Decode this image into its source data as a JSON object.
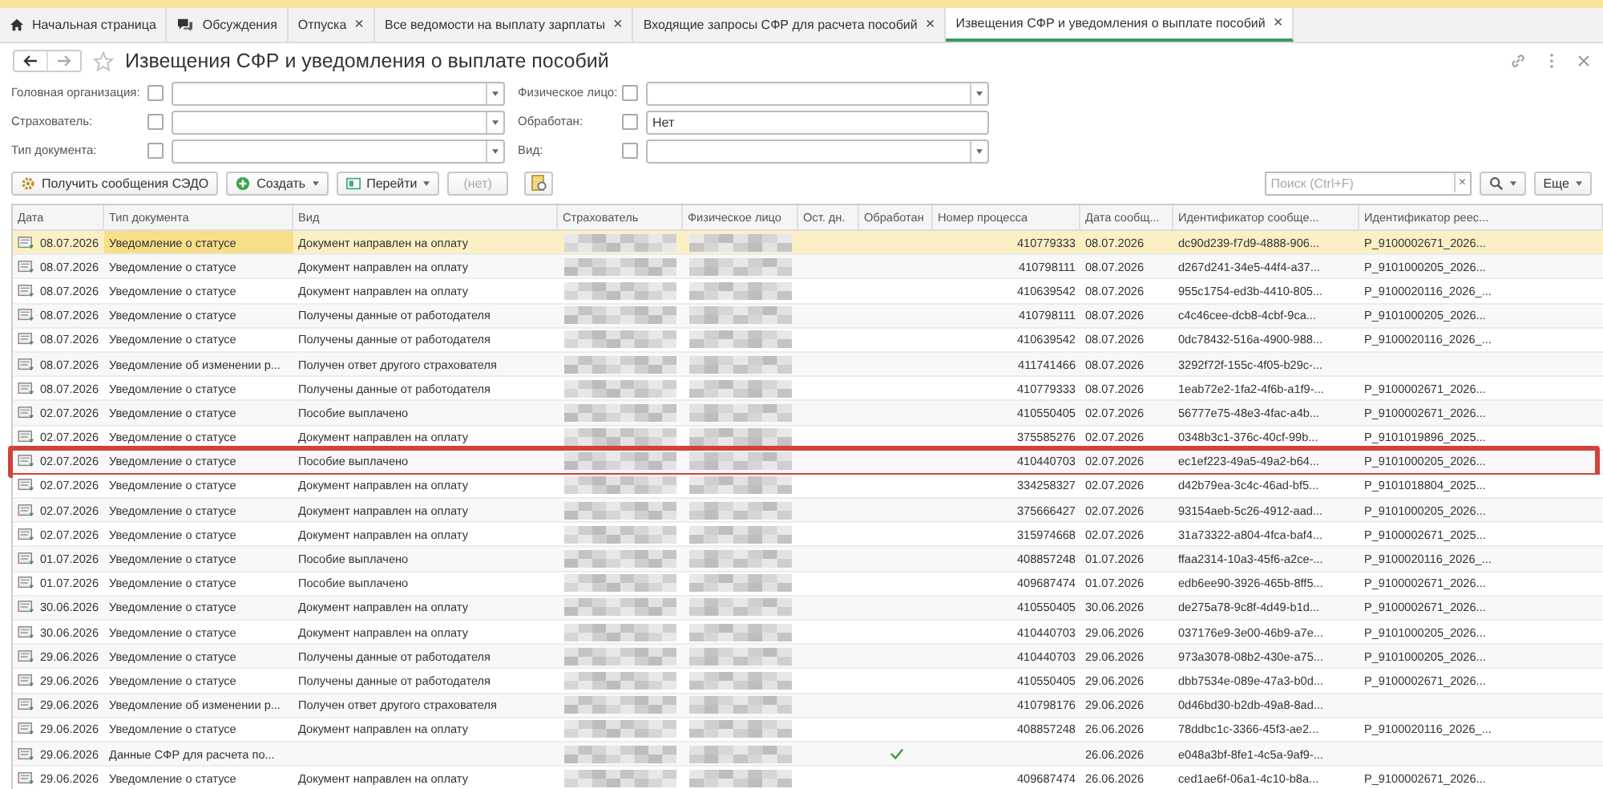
{
  "tabs": [
    {
      "label": "Начальная страница",
      "kind": "home",
      "selected": false
    },
    {
      "label": "Обсуждения",
      "kind": "chat",
      "selected": false
    },
    {
      "label": "Отпуска",
      "kind": "plain",
      "close": "×",
      "selected": false
    },
    {
      "label": "Все ведомости на выплату зарплаты",
      "kind": "plain",
      "close": "×",
      "selected": false
    },
    {
      "label": "Входящие запросы СФР для расчета пособий",
      "kind": "plain",
      "close": "×",
      "selected": false
    },
    {
      "label": "Извещения СФР и уведомления о выплате пособий",
      "kind": "plain",
      "close": "×",
      "selected": true
    }
  ],
  "title": "Извещения СФР и уведомления о выплате пособий",
  "filters_left": [
    {
      "label": "Головная организация:",
      "checked": false,
      "dropdown": true
    },
    {
      "label": "Страхователь:",
      "checked": false,
      "dropdown": true
    },
    {
      "label": "Тип документа:",
      "checked": false,
      "dropdown": true
    }
  ],
  "filters_right": [
    {
      "label": "Физическое лицо:",
      "checked": false,
      "dropdown": true
    },
    {
      "label": "Обработан:",
      "checked": false,
      "value": "Нет",
      "dropdown": false
    },
    {
      "label": "Вид:",
      "checked": false,
      "dropdown": true
    }
  ],
  "toolbar": [
    {
      "label": "Получить сообщения СЭДО",
      "kind": "receive",
      "menu": false,
      "disabled": false
    },
    {
      "label": "Создать",
      "kind": "create",
      "menu": true,
      "disabled": false
    },
    {
      "label": "Перейти",
      "kind": "goto",
      "menu": true,
      "disabled": false
    },
    {
      "label": "(нет)",
      "kind": "plain",
      "menu": false,
      "disabled": true
    }
  ],
  "search": {
    "placeholder": "Поиск (Ctrl+F)",
    "clear": "×"
  },
  "more_button": "Еще",
  "columns": [
    "Дата",
    "Тип документа",
    "Вид",
    "Страхователь",
    "Физическое лицо",
    "Ост. дн.",
    "Обработан",
    "Номер процесса",
    "Дата сообщ...",
    "Идентификатор сообще...",
    "Идентификатор реес..."
  ],
  "rows": [
    {
      "date": "08.07.2026",
      "type": "Уведомление о статусе",
      "kind_text": "Документ направлен на оплату",
      "processed": false,
      "process": "410779333",
      "msg_date": "08.07.2026",
      "msg_id": "dc90d239-f7d9-4888-906...",
      "reg_id": "P_9100002671_2026...",
      "selected": true,
      "annotated": false
    },
    {
      "date": "08.07.2026",
      "type": "Уведомление о статусе",
      "kind_text": "Документ направлен на оплату",
      "processed": false,
      "process": "410798111",
      "msg_date": "08.07.2026",
      "msg_id": "d267d241-34e5-44f4-a37...",
      "reg_id": "P_9101000205_2026...",
      "selected": false,
      "annotated": false
    },
    {
      "date": "08.07.2026",
      "type": "Уведомление о статусе",
      "kind_text": "Документ направлен на оплату",
      "processed": false,
      "process": "410639542",
      "msg_date": "08.07.2026",
      "msg_id": "955c1754-ed3b-4410-805...",
      "reg_id": "P_9100020116_2026_...",
      "selected": false,
      "annotated": false
    },
    {
      "date": "08.07.2026",
      "type": "Уведомление о статусе",
      "kind_text": "Получены данные от работодателя",
      "processed": false,
      "process": "410798111",
      "msg_date": "08.07.2026",
      "msg_id": "c4c46cee-dcb8-4cbf-9ca...",
      "reg_id": "P_9101000205_2026...",
      "selected": false,
      "annotated": false
    },
    {
      "date": "08.07.2026",
      "type": "Уведомление о статусе",
      "kind_text": "Получены данные от работодателя",
      "processed": false,
      "process": "410639542",
      "msg_date": "08.07.2026",
      "msg_id": "0dc78432-516a-4900-988...",
      "reg_id": "P_9100020116_2026_...",
      "selected": false,
      "annotated": false
    },
    {
      "date": "08.07.2026",
      "type": "Уведомление об изменении р...",
      "kind_text": "Получен ответ другого страхователя",
      "processed": false,
      "process": "411741466",
      "msg_date": "08.07.2026",
      "msg_id": "3292f72f-155c-4f05-b29c-...",
      "selected": false,
      "annotated": false
    },
    {
      "date": "08.07.2026",
      "type": "Уведомление о статусе",
      "kind_text": "Получены данные от работодателя",
      "processed": false,
      "process": "410779333",
      "msg_date": "08.07.2026",
      "msg_id": "1eab72e2-1fa2-4f6b-a1f9-...",
      "reg_id": "P_9100002671_2026...",
      "selected": false,
      "annotated": false
    },
    {
      "date": "02.07.2026",
      "type": "Уведомление о статусе",
      "kind_text": "Пособие выплачено",
      "processed": false,
      "process": "410550405",
      "msg_date": "02.07.2026",
      "msg_id": "56777e75-48e3-4fac-a4b...",
      "reg_id": "P_9100002671_2026...",
      "selected": false,
      "annotated": false
    },
    {
      "date": "02.07.2026",
      "type": "Уведомление о статусе",
      "kind_text": "Документ направлен на оплату",
      "processed": false,
      "process": "375585276",
      "msg_date": "02.07.2026",
      "msg_id": "0348b3c1-376c-40cf-99b...",
      "reg_id": "P_9101019896_2025...",
      "selected": false,
      "annotated": false
    },
    {
      "date": "02.07.2026",
      "type": "Уведомление о статусе",
      "kind_text": "Пособие выплачено",
      "processed": false,
      "process": "410440703",
      "msg_date": "02.07.2026",
      "msg_id": "ec1ef223-49a5-49a2-b64...",
      "reg_id": "P_9101000205_2026...",
      "selected": false,
      "annotated": true
    },
    {
      "date": "02.07.2026",
      "type": "Уведомление о статусе",
      "kind_text": "Документ направлен на оплату",
      "processed": false,
      "process": "334258327",
      "msg_date": "02.07.2026",
      "msg_id": "d42b79ea-3c4c-46ad-bf5...",
      "reg_id": "P_9101018804_2025...",
      "selected": false,
      "annotated": false
    },
    {
      "date": "02.07.2026",
      "type": "Уведомление о статусе",
      "kind_text": "Документ направлен на оплату",
      "processed": false,
      "process": "375666427",
      "msg_date": "02.07.2026",
      "msg_id": "93154aeb-5c26-4912-aad...",
      "reg_id": "P_9101000205_2026...",
      "selected": false,
      "annotated": false
    },
    {
      "date": "02.07.2026",
      "type": "Уведомление о статусе",
      "kind_text": "Документ направлен на оплату",
      "processed": false,
      "process": "315974668",
      "msg_date": "02.07.2026",
      "msg_id": "31a73322-a804-4fca-baf4...",
      "reg_id": "P_9100002671_2025...",
      "selected": false,
      "annotated": false
    },
    {
      "date": "01.07.2026",
      "type": "Уведомление о статусе",
      "kind_text": "Пособие выплачено",
      "processed": false,
      "process": "408857248",
      "msg_date": "01.07.2026",
      "msg_id": "ffaa2314-10a3-45f6-a2ce-...",
      "reg_id": "P_9100020116_2026_...",
      "selected": false,
      "annotated": false
    },
    {
      "date": "01.07.2026",
      "type": "Уведомление о статусе",
      "kind_text": "Пособие выплачено",
      "processed": false,
      "process": "409687474",
      "msg_date": "01.07.2026",
      "msg_id": "edb6ee90-3926-465b-8ff5...",
      "reg_id": "P_9100002671_2026...",
      "selected": false,
      "annotated": false
    },
    {
      "date": "30.06.2026",
      "type": "Уведомление о статусе",
      "kind_text": "Документ направлен на оплату",
      "processed": false,
      "process": "410550405",
      "msg_date": "30.06.2026",
      "msg_id": "de275a78-9c8f-4d49-b1d...",
      "reg_id": "P_9100002671_2026...",
      "selected": false,
      "annotated": false
    },
    {
      "date": "30.06.2026",
      "type": "Уведомление о статусе",
      "kind_text": "Документ направлен на оплату",
      "processed": false,
      "process": "410440703",
      "msg_date": "29.06.2026",
      "msg_id": "037176e9-3e00-46b9-a7e...",
      "reg_id": "P_9101000205_2026...",
      "selected": false,
      "annotated": false
    },
    {
      "date": "29.06.2026",
      "type": "Уведомление о статусе",
      "kind_text": "Получены данные от работодателя",
      "processed": false,
      "process": "410440703",
      "msg_date": "29.06.2026",
      "msg_id": "973a3078-08b2-430e-a75...",
      "reg_id": "P_9101000205_2026...",
      "selected": false,
      "annotated": false
    },
    {
      "date": "29.06.2026",
      "type": "Уведомление о статусе",
      "kind_text": "Получены данные от работодателя",
      "processed": false,
      "process": "410550405",
      "msg_date": "29.06.2026",
      "msg_id": "dbb7534e-089e-47a3-b0d...",
      "reg_id": "P_9100002671_2026...",
      "selected": false,
      "annotated": false
    },
    {
      "date": "29.06.2026",
      "type": "Уведомление об изменении р...",
      "kind_text": "Получен ответ другого страхователя",
      "processed": false,
      "process": "410798176",
      "msg_date": "29.06.2026",
      "msg_id": "0d46bd30-b2db-49a8-8ad...",
      "selected": false,
      "annotated": false
    },
    {
      "date": "29.06.2026",
      "type": "Уведомление о статусе",
      "kind_text": "Документ направлен на оплату",
      "processed": false,
      "process": "408857248",
      "msg_date": "26.06.2026",
      "msg_id": "78ddbc1c-3366-45f3-ae2...",
      "reg_id": "P_9100020116_2026_...",
      "selected": false,
      "annotated": false
    },
    {
      "date": "29.06.2026",
      "type": "Данные СФР для расчета по...",
      "processed": true,
      "msg_date": "26.06.2026",
      "msg_id": "e048a3bf-8fe1-4c5a-9af9-...",
      "selected": false,
      "annotated": false
    },
    {
      "date": "29.06.2026",
      "type": "Уведомление о статусе",
      "kind_text": "Документ направлен на оплату",
      "processed": false,
      "process": "409687474",
      "msg_date": "26.06.2026",
      "msg_id": "ced1ae6f-06a1-4c10-b8a...",
      "reg_id": "P_9100002671_2026...",
      "selected": false,
      "annotated": false
    }
  ]
}
